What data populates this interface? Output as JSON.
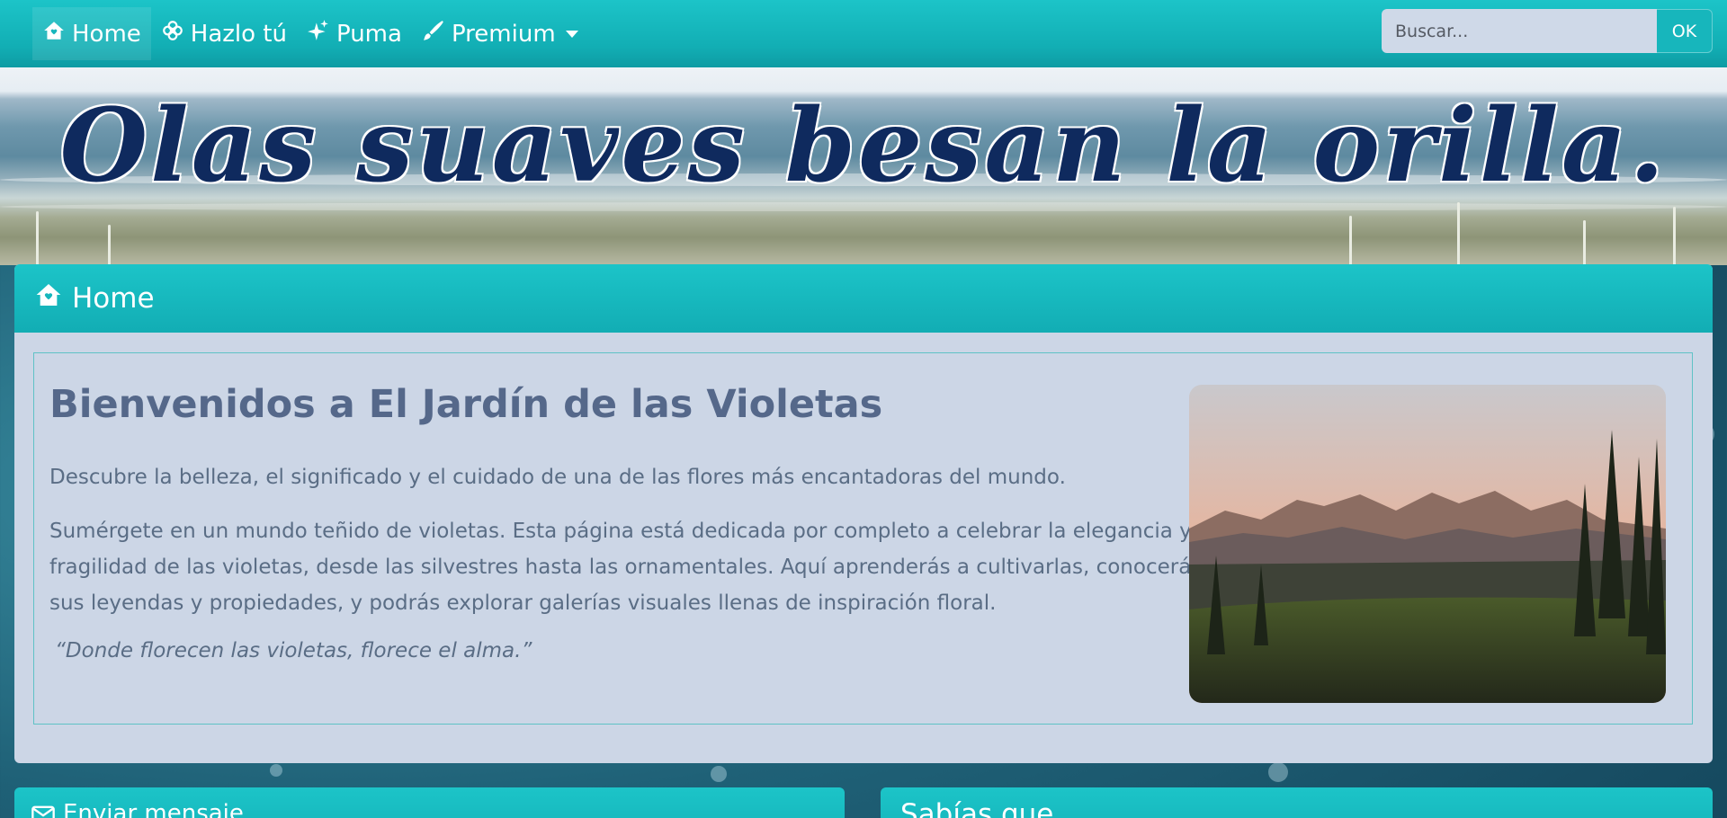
{
  "nav": {
    "items": [
      {
        "label": "Home",
        "icon": "home-icon"
      },
      {
        "label": "Hazlo tú",
        "icon": "flower-icon"
      },
      {
        "label": "Puma",
        "icon": "sparkles-icon"
      },
      {
        "label": "Premium",
        "icon": "brush-icon"
      }
    ],
    "search_placeholder": "Buscar...",
    "search_button": "OK"
  },
  "banner": {
    "title": "Olas suaves besan la orilla."
  },
  "main": {
    "header": "Home",
    "welcome_title": "Bienvenidos a El Jardín de las Violetas",
    "intro": "Descubre la belleza, el significado y el cuidado de una de las flores más encantadoras del mundo.",
    "paragraph": "Sumérgete en un mundo teñido de violetas. Esta página está dedicada por completo a celebrar la elegancia y fragilidad de las violetas, desde las silvestres hasta las ornamentales. Aquí aprenderás a cultivarlas, conocerás sus leyendas y propiedades, y podrás explorar galerías visuales llenas de inspiración floral.",
    "quote": "“Donde florecen las violetas, florece el alma.”"
  },
  "bottom": {
    "left_title": "Enviar mensaje",
    "right_title": "Sabías que"
  },
  "colors": {
    "accent": "#17b6bc",
    "card_bg": "#ccd6e6",
    "title_text": "#55688a",
    "banner_title": "#0f2a5e"
  }
}
